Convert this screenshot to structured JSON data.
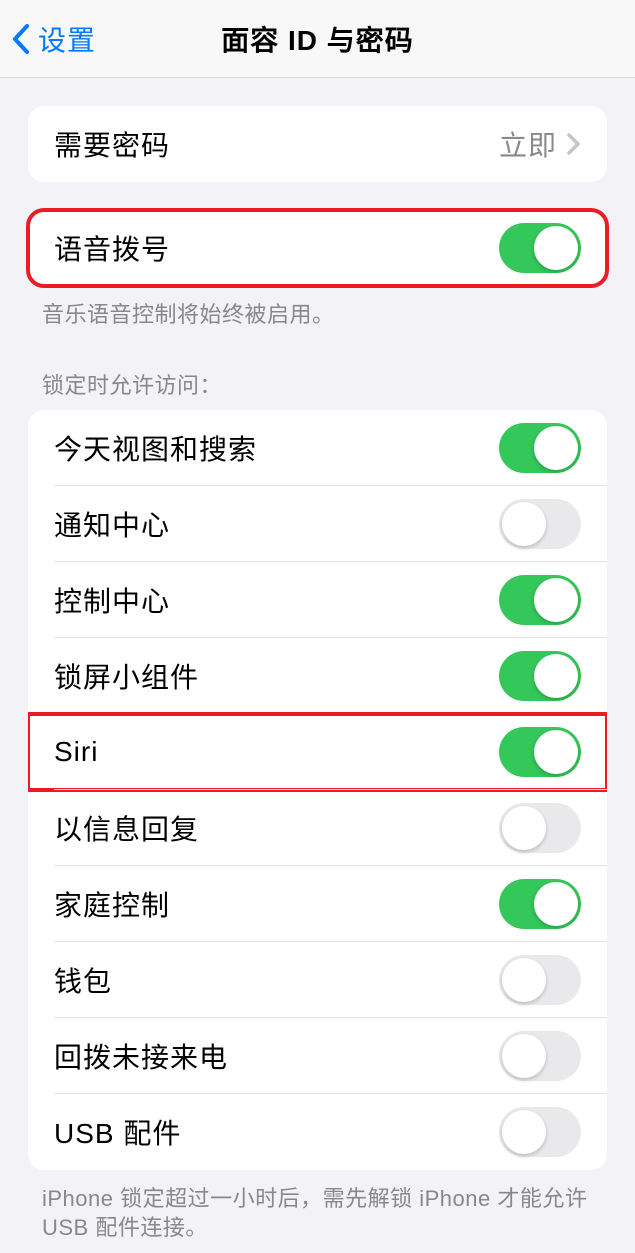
{
  "nav": {
    "back_label": "设置",
    "title": "面容 ID 与密码"
  },
  "require_passcode": {
    "label": "需要密码",
    "value": "立即"
  },
  "voice_dial": {
    "label": "语音拨号",
    "footer": "音乐语音控制将始终被启用。"
  },
  "locked_access": {
    "header": "锁定时允许访问：",
    "items": [
      {
        "label": "今天视图和搜索",
        "on": true
      },
      {
        "label": "通知中心",
        "on": false
      },
      {
        "label": "控制中心",
        "on": true
      },
      {
        "label": "锁屏小组件",
        "on": true
      },
      {
        "label": "Siri",
        "on": true
      },
      {
        "label": "以信息回复",
        "on": false
      },
      {
        "label": "家庭控制",
        "on": true
      },
      {
        "label": "钱包",
        "on": false
      },
      {
        "label": "回拨未接来电",
        "on": false
      },
      {
        "label": "USB 配件",
        "on": false
      }
    ],
    "footer": "iPhone 锁定超过一小时后，需先解锁 iPhone 才能允许 USB 配件连接。"
  }
}
